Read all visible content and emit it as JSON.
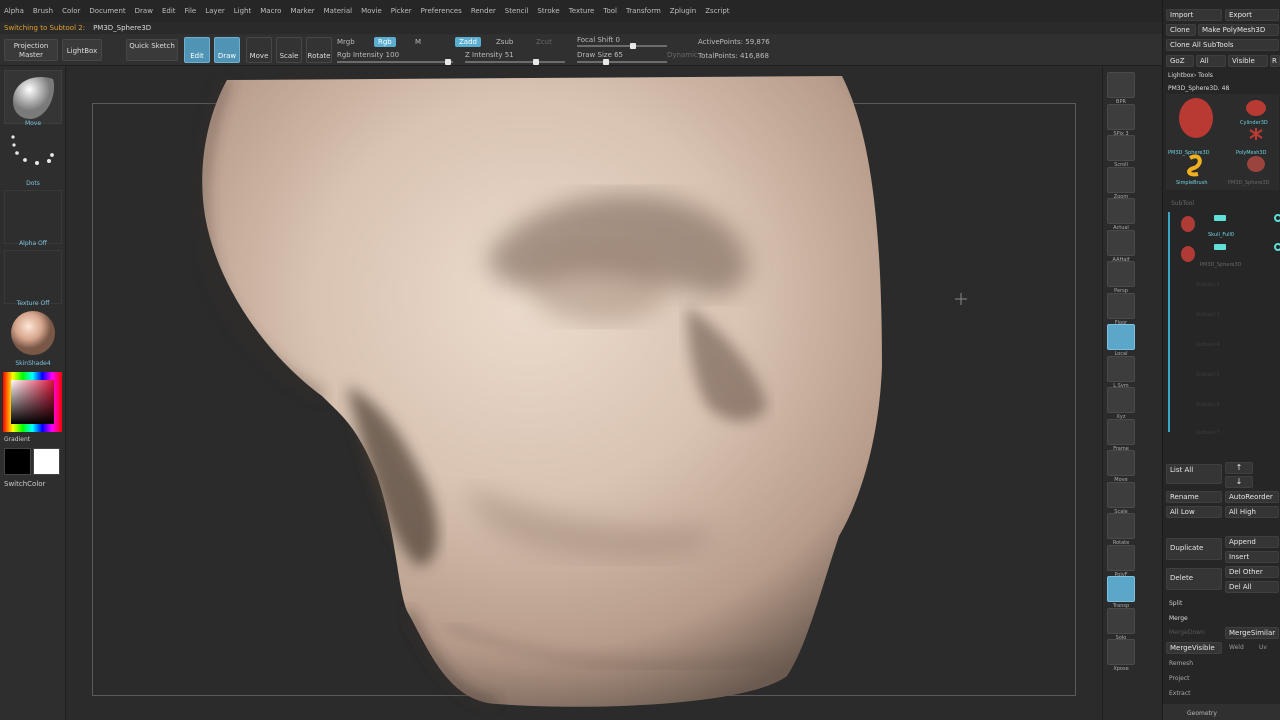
{
  "menu": [
    "Alpha",
    "Brush",
    "Color",
    "Document",
    "Draw",
    "Edit",
    "File",
    "Layer",
    "Light",
    "Macro",
    "Marker",
    "Material",
    "Movie",
    "Picker",
    "Preferences",
    "Render",
    "Stencil",
    "Stroke",
    "Texture",
    "Tool",
    "Transform",
    "Zplugin",
    "Zscript"
  ],
  "notice": {
    "message": "Switching to Subtool 2:",
    "tool": "PM3D_Sphere3D"
  },
  "toolbar": {
    "projection_master": "Projection Master",
    "lightbox": "LightBox",
    "quick_sketch": "Quick Sketch",
    "edit": "Edit",
    "draw": "Draw",
    "move": "Move",
    "scale": "Scale",
    "rotate": "Rotate",
    "mrgb": "Mrgb",
    "rgb": "Rgb",
    "m": "M",
    "rgb_intensity": "Rgb Intensity 100",
    "zadd": "Zadd",
    "zsub": "Zsub",
    "zcut": "Zcut",
    "z_intensity": "Z Intensity 51",
    "focal_shift": "Focal Shift 0",
    "draw_size": "Draw Size 65",
    "dynamic": "Dynamic",
    "active_points": "ActivePoints: 59,876",
    "total_points": "TotalPoints: 416,868"
  },
  "left_shelf": {
    "brush_label": "Move",
    "stroke_label": "Dots",
    "alpha_label": "Alpha Off",
    "texture_label": "Texture Off",
    "material_label": "SkinShade4",
    "gradient_label": "Gradient",
    "switch_color_label": "SwitchColor",
    "main_color": "#000000",
    "secondary_color": "#ffffff"
  },
  "right_shelf": [
    "BPR",
    "SPix 3",
    "Scroll",
    "Zoom",
    "Actual",
    "AAHalf",
    "Persp",
    "Floor",
    "Local",
    "L.Sym",
    "Xyz",
    "Frame",
    "Move",
    "Scale",
    "Rotate",
    "PolyF",
    "Transp",
    "Solo",
    "Xpose"
  ],
  "tool_tray": {
    "import": "Import",
    "export": "Export",
    "clone": "Clone",
    "make_polymesh": "Make PolyMesh3D",
    "clone_all": "Clone All SubTools",
    "goz": "GoZ",
    "all": "All",
    "visible": "Visible",
    "r": "R",
    "lightbox_tools": "Lightbox› Tools",
    "current_tool": "PM3D_Sphere3D. 48",
    "thumbs": [
      "PM3D_Sphere3D",
      "Cylinder3D",
      "PolyMesh3D",
      "SimpleBrush",
      "PM3D_Sphere3D"
    ],
    "subtool_header": "SubTool",
    "subtools": [
      "Skull_Full0",
      "PM3D_Sphere3D"
    ],
    "empty_slots": [
      "Subtool 2",
      "Subtool 3",
      "Subtool 4",
      "Subtool 5",
      "Subtool 6",
      "Subtool 7"
    ],
    "list_all": "List All",
    "rename": "Rename",
    "auto_reorder": "AutoReorder",
    "all_low": "All Low",
    "all_high": "All High",
    "duplicate": "Duplicate",
    "append": "Append",
    "insert": "Insert",
    "delete": "Delete",
    "del_other": "Del Other",
    "del_all": "Del All",
    "split": "Split",
    "merge": "Merge",
    "merge_down": "MergeDown",
    "merge_similar": "MergeSimilar",
    "merge_visible": "MergeVisible",
    "weld": "Weld",
    "uv": "Uv",
    "remesh": "Remesh",
    "project": "Project",
    "extract": "Extract",
    "geometry": "Geometry"
  },
  "colors": {
    "accent": "#5aaed0",
    "teal": "#6fd2df",
    "skull": "#d9c3b2",
    "warning": "#e0a030"
  }
}
